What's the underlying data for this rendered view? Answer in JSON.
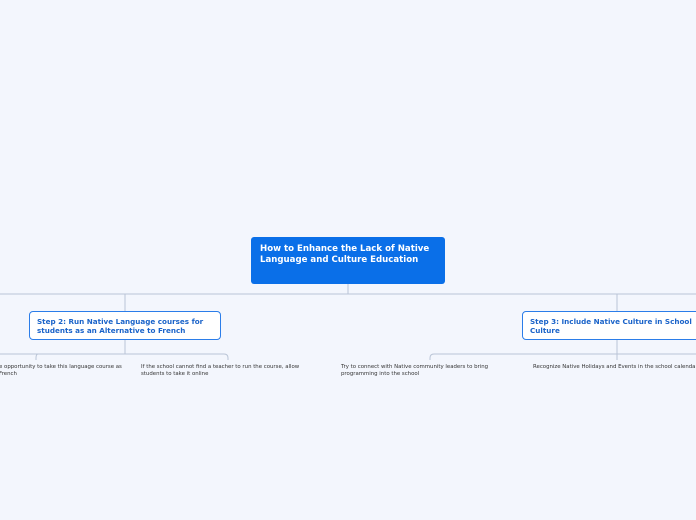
{
  "root": {
    "title": "How to Enhance the Lack of Native Language and Culture Education"
  },
  "topics": {
    "step2": "Step 2: Run Native Language courses for students as an Alternative to French",
    "step3": "Step 3: Include Native Culture in School Culture"
  },
  "subtopics": {
    "step2_a": "e opportunity to take this language course as French",
    "step2_b": "If the school cannot find a teacher to run the course, allow students to take it online",
    "step3_a": "Try to connect with Native community leaders to bring programming into the school",
    "step3_b": "Recognize Native Holidays and Events in the school calenda"
  },
  "colors": {
    "background": "#f3f6fd",
    "root_fill": "#0a6fe8",
    "topic_border": "#2b7de9",
    "topic_text": "#1a63c9",
    "connector": "#b9c4d6"
  }
}
